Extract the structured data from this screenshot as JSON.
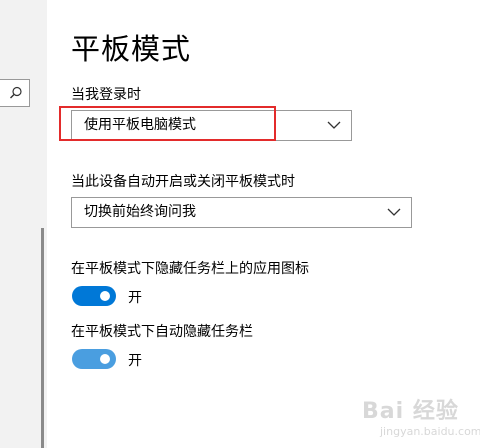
{
  "page": {
    "title": "平板模式"
  },
  "settings": {
    "signin_label": "当我登录时",
    "signin_value": "使用平板电脑模式",
    "switch_label": "当此设备自动开启或关闭平板模式时",
    "switch_value": "切换前始终询问我",
    "hide_icons_label": "在平板模式下隐藏任务栏上的应用图标",
    "hide_icons_state": "开",
    "hide_icons_on": true,
    "autohide_label": "在平板模式下自动隐藏任务栏",
    "autohide_state": "开",
    "autohide_on": true
  },
  "nav": {
    "search_icon": "search-icon"
  },
  "watermark": {
    "text": "Bai 经验",
    "sub": "jingyan.baidu.com"
  },
  "colors": {
    "accent": "#0078d7",
    "accent_light": "#4a9ee0",
    "highlight": "#e32b2b"
  }
}
